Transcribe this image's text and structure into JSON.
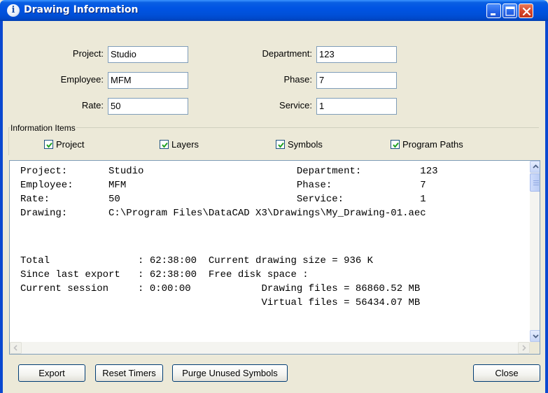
{
  "window": {
    "title": "Drawing Information",
    "title_icon": "info-icon"
  },
  "form": {
    "project_label": "Project:",
    "project_value": "Studio",
    "employee_label": "Employee:",
    "employee_value": "MFM",
    "rate_label": "Rate:",
    "rate_value": "50",
    "department_label": "Department:",
    "department_value": "123",
    "phase_label": "Phase:",
    "phase_value": "7",
    "service_label": "Service:",
    "service_value": "1"
  },
  "info_items": {
    "title": "Information Items",
    "checkboxes": [
      {
        "label": "Project",
        "checked": true
      },
      {
        "label": "Layers",
        "checked": true
      },
      {
        "label": "Symbols",
        "checked": true
      },
      {
        "label": "Program Paths",
        "checked": true
      }
    ]
  },
  "output": {
    "lines": [
      "Project:       Studio                          Department:          123",
      "Employee:      MFM                             Phase:               7",
      "Rate:          50                              Service:             1",
      "Drawing:       C:\\Program Files\\DataCAD X3\\Drawings\\My_Drawing-01.aec",
      "",
      "",
      "Total               : 62:38:00  Current drawing size = 936 K",
      "Since last export   : 62:38:00  Free disk space :",
      "Current session     : 0:00:00            Drawing files = 86860.52 MB",
      "                                         Virtual files = 56434.07 MB"
    ]
  },
  "buttons": {
    "export": "Export",
    "reset_timers": "Reset Timers",
    "purge": "Purge Unused Symbols",
    "close": "Close"
  },
  "colors": {
    "titlebar": "#0054e3",
    "face": "#ece9d8",
    "checkmark": "#21a121"
  }
}
